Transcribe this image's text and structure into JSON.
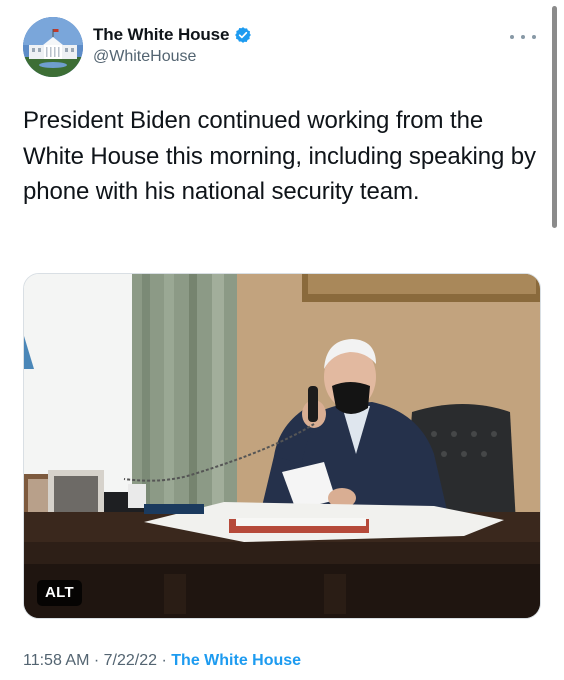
{
  "author": {
    "display_name": "The White House",
    "handle": "@WhiteHouse",
    "verified": true,
    "avatar": "white-house-building-avatar"
  },
  "tweet": {
    "text": "President Biden continued working from the White House this morning, including speaking by phone with his national security team."
  },
  "media": {
    "alt_badge": "ALT",
    "description_icon": "photo"
  },
  "meta": {
    "time": "11:58 AM",
    "separator": "·",
    "date": "7/22/22",
    "source": "The White House"
  },
  "colors": {
    "text": "#0f1419",
    "secondary": "#536471",
    "accent": "#1d9bf0"
  }
}
